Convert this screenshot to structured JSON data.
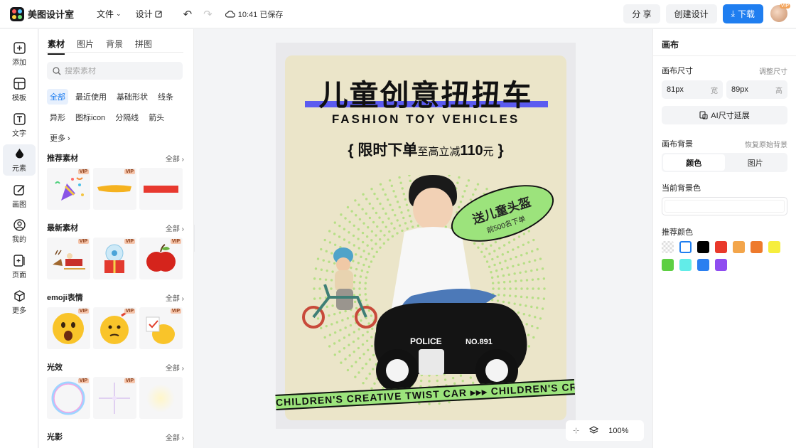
{
  "app": {
    "name": "美图设计室"
  },
  "menu": {
    "file": "文件",
    "design": "设计",
    "save_status": "10:41 已保存"
  },
  "actions": {
    "share": "分 享",
    "create": "创建设计",
    "download": "下载"
  },
  "user": {
    "badge": "VIP"
  },
  "rail": [
    {
      "label": "添加",
      "icon": "plus-square-icon"
    },
    {
      "label": "模板",
      "icon": "template-icon"
    },
    {
      "label": "文字",
      "icon": "text-icon"
    },
    {
      "label": "元素",
      "icon": "shapes-icon"
    },
    {
      "label": "画图",
      "icon": "draw-icon"
    },
    {
      "label": "我的",
      "icon": "user-icon"
    },
    {
      "label": "页面",
      "icon": "page-add-icon"
    },
    {
      "label": "更多",
      "icon": "cube-icon"
    }
  ],
  "panel": {
    "tabs": [
      "素材",
      "图片",
      "背景",
      "拼图"
    ],
    "search_placeholder": "搜索素材",
    "chips": [
      "全部",
      "最近使用",
      "基础形状",
      "线条",
      "异形",
      "图标icon",
      "分隔线",
      "箭头",
      "更多"
    ],
    "sections": [
      {
        "title": "推荐素材",
        "all": "全部"
      },
      {
        "title": "最新素材",
        "all": "全部"
      },
      {
        "title": "emoji表情",
        "all": "全部"
      },
      {
        "title": "光效",
        "all": "全部"
      },
      {
        "title": "光影",
        "all": "全部"
      }
    ],
    "vip": "VIP"
  },
  "poster": {
    "title": "儿童创意扭扭车",
    "subtitle": "FASHION TOY VEHICLES",
    "promo_open": "{",
    "promo_main": "限时下单",
    "promo_mid": "至高立减",
    "promo_num": "110",
    "promo_unit": "元",
    "promo_close": "}",
    "badge_main": "送儿童头盔",
    "badge_sub": "前500名下单",
    "car_text": "POLICE",
    "car_number": "NO.891",
    "ribbon": "CHILDREN'S CREATIVE TWIST CAR ▸▸▸   CHILDREN'S CREATIVE TWIST CAR ▸▸▸"
  },
  "canvas_tools": {
    "zoom": "100%"
  },
  "right_panel": {
    "title": "画布",
    "size_label": "画布尺寸",
    "size_link": "调整尺寸",
    "width_value": "81px",
    "width_unit": "宽",
    "height_value": "89px",
    "height_unit": "高",
    "ai_button": "AI尺寸延展",
    "bg_label": "画布背景",
    "bg_link": "恢复原始背景",
    "seg_color": "颜色",
    "seg_image": "图片",
    "current_bg_label": "当前背景色",
    "recommend_label": "推荐颜色",
    "swatches": [
      "transparent",
      "#ffffff",
      "#000000",
      "#e9392b",
      "#f3a54a",
      "#ee7a2c",
      "#f6ee3d",
      "#5dcf43",
      "#62ece8",
      "#2a7ff0",
      "#8f4df0"
    ]
  }
}
